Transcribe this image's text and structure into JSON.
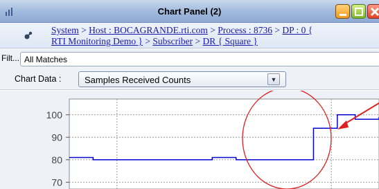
{
  "window": {
    "title": "Chart Panel (2)",
    "app_icon": "bar-chart-icon",
    "buttons": [
      "minimize-icon",
      "maximize-icon",
      "close-icon"
    ]
  },
  "breadcrumb": {
    "icon": "topic-icon",
    "separator": " > ",
    "items": [
      "System",
      "Host : BOCAGRANDE.rti.com",
      "Process : 8736",
      "DP : 0 { RTI Monitoring Demo }",
      "Subscriber",
      "DR { Square }"
    ]
  },
  "filter": {
    "label": "Filt...",
    "value": "All Matches"
  },
  "chart_data_selector": {
    "label": "Chart Data :",
    "value": "Samples Received Counts"
  },
  "chart_data": {
    "type": "line",
    "title": "",
    "xlabel": "",
    "ylabel": "",
    "ylim": [
      67,
      107
    ],
    "y_ticks": [
      70,
      80,
      90,
      100
    ],
    "grid": true,
    "series": [
      {
        "color": "#0000d0",
        "x": [
          0,
          2,
          10,
          12,
          14,
          16,
          19,
          20,
          20.5,
          22,
          22.5,
          24,
          26
        ],
        "y": [
          81,
          80,
          80,
          81,
          80,
          80,
          80,
          80,
          94,
          94,
          100,
          98,
          99
        ]
      }
    ],
    "annotations": {
      "highlight_circle_color": "#e02020",
      "arrow_color": "#e02020"
    }
  }
}
